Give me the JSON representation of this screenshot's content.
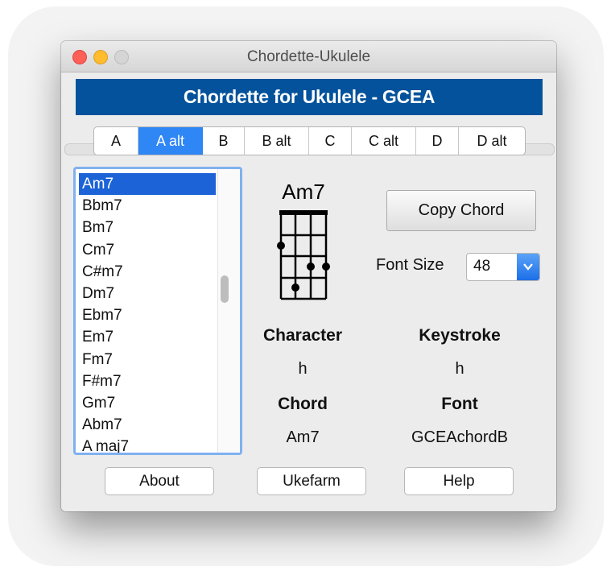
{
  "window": {
    "title": "Chordette-Ukulele"
  },
  "banner": {
    "title": "Chordette for Ukulele - GCEA"
  },
  "tabs": [
    "A",
    "A alt",
    "B",
    "B alt",
    "C",
    "C alt",
    "D",
    "D alt"
  ],
  "selected_tab": "A alt",
  "chord_list": [
    "Am7",
    "Bbm7",
    "Bm7",
    "Cm7",
    "C#m7",
    "Dm7",
    "Ebm7",
    "Em7",
    "Fm7",
    "F#m7",
    "Gm7",
    "Abm7",
    "A maj7"
  ],
  "selected_chord": "Am7",
  "chord_display": {
    "name": "Am7"
  },
  "copy_button": "Copy Chord",
  "font_size": {
    "label": "Font Size",
    "value": "48"
  },
  "info": {
    "character_label": "Character",
    "character_value": "h",
    "keystroke_label": "Keystroke",
    "keystroke_value": "h",
    "chord_label": "Chord",
    "chord_value": "Am7",
    "font_label": "Font",
    "font_value": "GCEAchordB"
  },
  "buttons": {
    "about": "About",
    "ukefarm": "Ukefarm",
    "help": "Help"
  },
  "colors": {
    "banner": "#03529b",
    "selected_tab": "#2f86f5",
    "selected_row": "#1b63d6"
  }
}
